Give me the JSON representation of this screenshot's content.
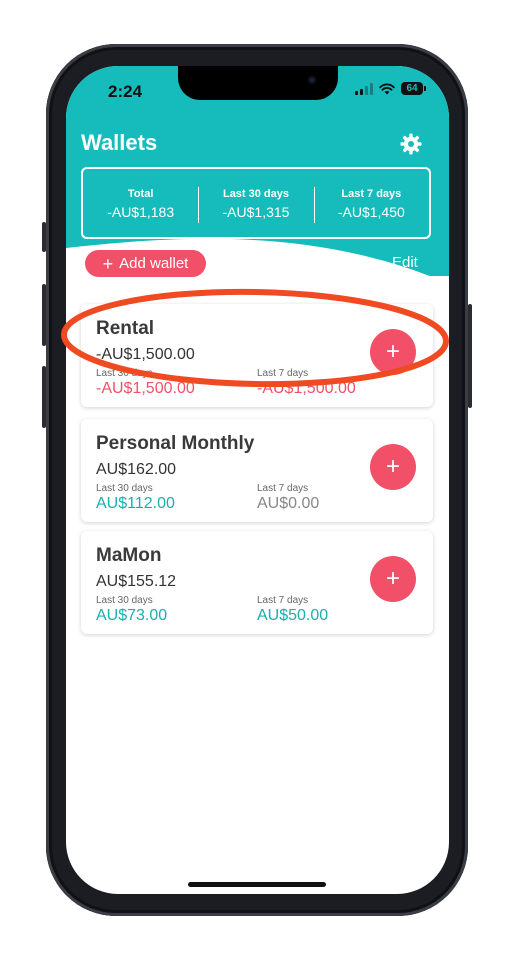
{
  "status_bar": {
    "time": "2:24",
    "battery": "64"
  },
  "header": {
    "title": "Wallets",
    "settings_icon": "gear-icon"
  },
  "summary": [
    {
      "label": "Total",
      "value": "-AU$1,183"
    },
    {
      "label": "Last 30 days",
      "value": "-AU$1,315"
    },
    {
      "label": "Last 7 days",
      "value": "-AU$1,450"
    }
  ],
  "actions": {
    "add_wallet": "Add wallet",
    "edit": "Edit"
  },
  "wallets": [
    {
      "name": "Rental",
      "balance": "-AU$1,500.00",
      "last30_label": "Last 30 days",
      "last30": "-AU$1,500.00",
      "last7_label": "Last 7 days",
      "last7": "-AU$1,500.00"
    },
    {
      "name": "Personal Monthly",
      "balance": "AU$162.00",
      "last30_label": "Last 30 days",
      "last30": "AU$112.00",
      "last7_label": "Last 7 days",
      "last7": "AU$0.00"
    },
    {
      "name": "MaMon",
      "balance": "AU$155.12",
      "last30_label": "Last 30 days",
      "last30": "AU$73.00",
      "last7_label": "Last 7 days",
      "last7": "AU$50.00"
    }
  ],
  "colors": {
    "teal": "#16bcbc",
    "accent": "#f25069",
    "negative": "#f25069",
    "positive": "#16b0b0",
    "neutral": "#888888",
    "annotation": "#ef4a22"
  }
}
